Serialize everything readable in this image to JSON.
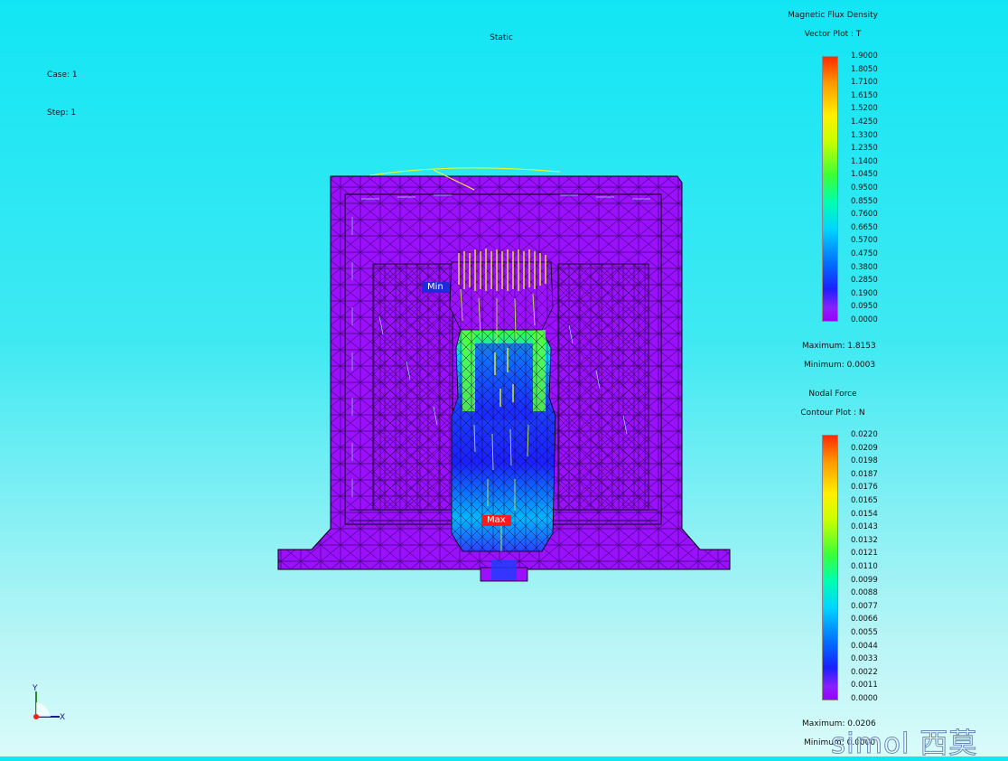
{
  "header": {
    "analysis_type": "Static",
    "case": "Case: 1",
    "step": "Step: 1"
  },
  "flux_legend": {
    "title": "Magnetic Flux Density",
    "subtitle": "Vector Plot : T",
    "ticks": [
      "1.9000",
      "1.8050",
      "1.7100",
      "1.6150",
      "1.5200",
      "1.4250",
      "1.3300",
      "1.2350",
      "1.1400",
      "1.0450",
      "0.9500",
      "0.8550",
      "0.7600",
      "0.6650",
      "0.5700",
      "0.4750",
      "0.3800",
      "0.2850",
      "0.1900",
      "0.0950",
      "0.0000"
    ],
    "maximum": "Maximum: 1.8153",
    "minimum": "Minimum: 0.0003"
  },
  "force_legend": {
    "title": "Nodal Force",
    "subtitle": "Contour Plot : N",
    "ticks": [
      "0.0220",
      "0.0209",
      "0.0198",
      "0.0187",
      "0.0176",
      "0.0165",
      "0.0154",
      "0.0143",
      "0.0132",
      "0.0121",
      "0.0110",
      "0.0099",
      "0.0088",
      "0.0077",
      "0.0066",
      "0.0055",
      "0.0044",
      "0.0033",
      "0.0022",
      "0.0011",
      "0.0000"
    ],
    "maximum": "Maximum: 0.0206",
    "minimum": "Minimum: 0.0000"
  },
  "markers": {
    "min": "Min",
    "max": "Max"
  },
  "axes": {
    "x": "X",
    "y": "Y"
  },
  "watermark": "simol 西莫",
  "colors": {
    "background_top": "#12e6f4",
    "mesh_fill": "#9a10ff",
    "min_tag": "#1f2bd6",
    "max_tag": "#ff1a1a"
  }
}
